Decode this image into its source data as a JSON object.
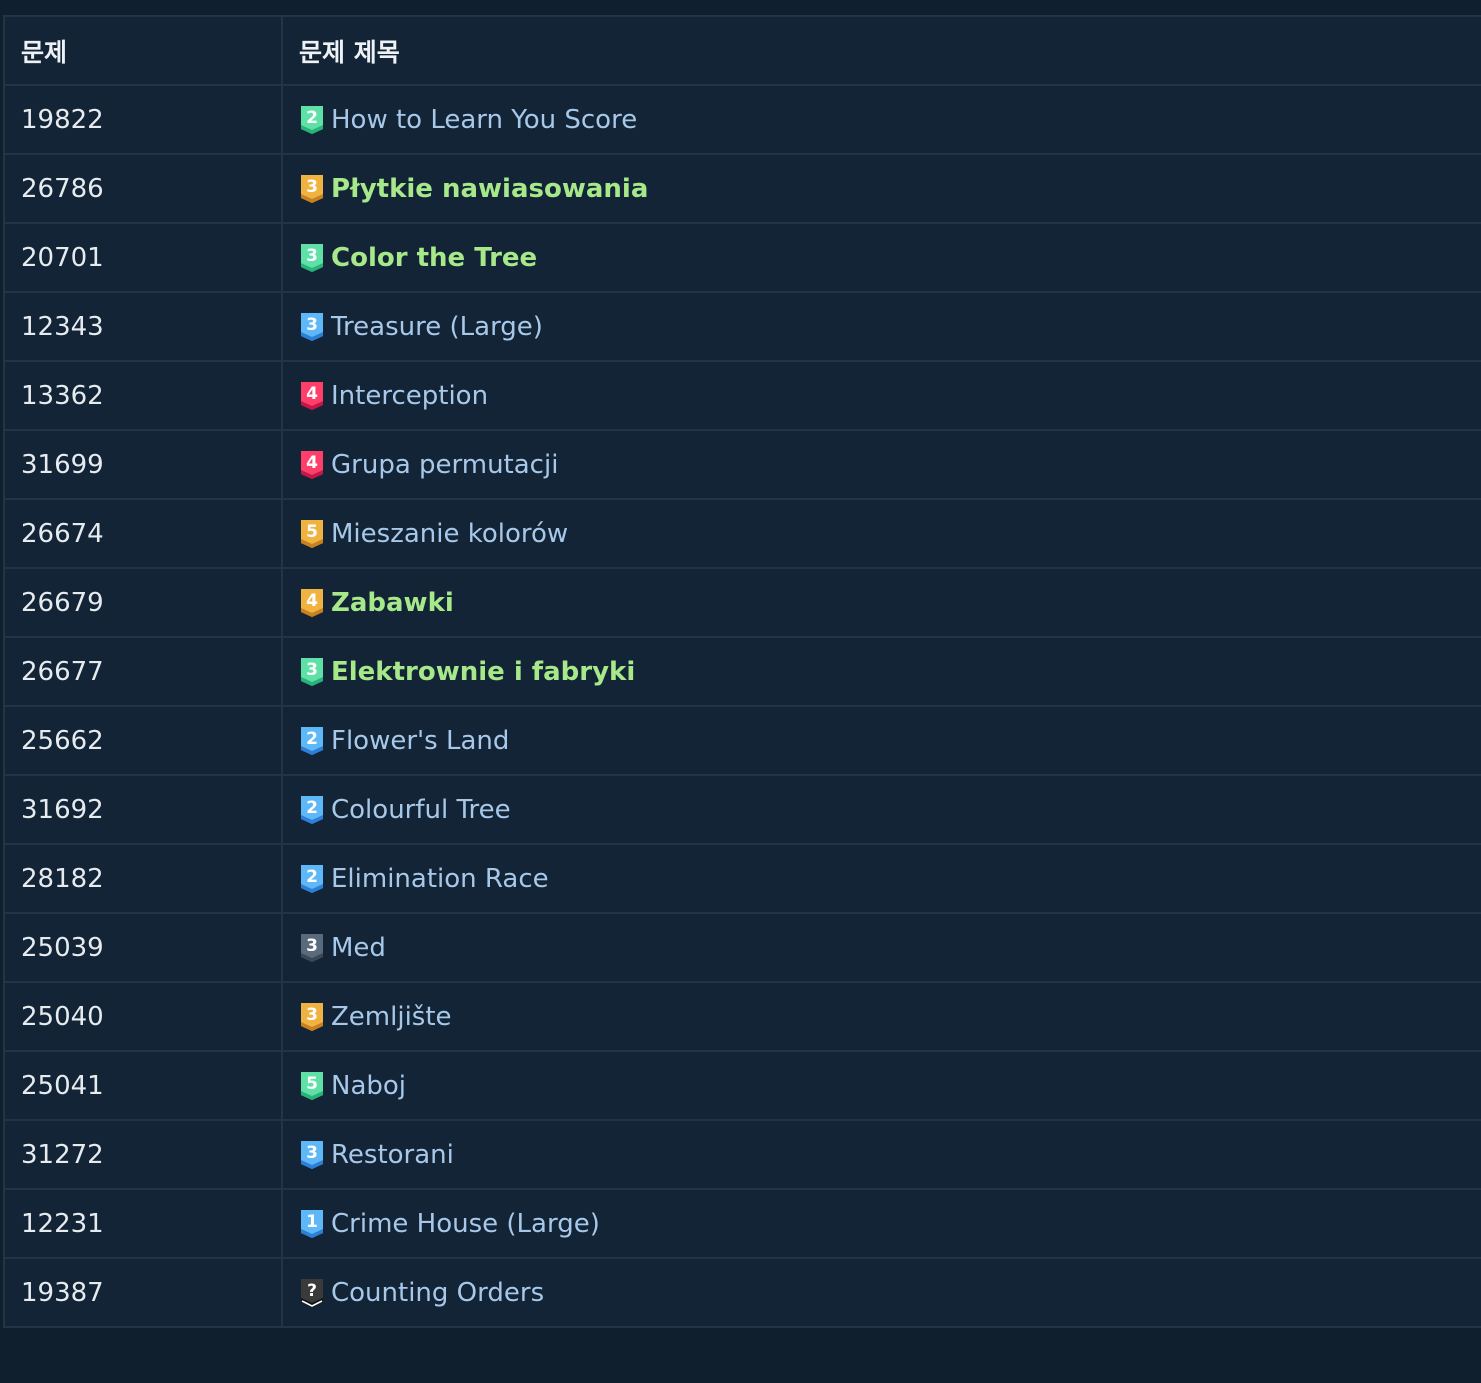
{
  "table": {
    "headers": [
      "문제",
      "문제 제목"
    ],
    "rows": [
      {
        "id": "19822",
        "title": "How to Learn You Score",
        "level": "2",
        "tier": "emerald",
        "solved": false
      },
      {
        "id": "26786",
        "title": "Płytkie nawiasowania",
        "level": "3",
        "tier": "gold",
        "solved": true
      },
      {
        "id": "20701",
        "title": "Color the Tree",
        "level": "3",
        "tier": "emerald",
        "solved": true
      },
      {
        "id": "12343",
        "title": "Treasure (Large)",
        "level": "3",
        "tier": "diamond",
        "solved": false
      },
      {
        "id": "13362",
        "title": "Interception",
        "level": "4",
        "tier": "ruby",
        "solved": false
      },
      {
        "id": "31699",
        "title": "Grupa permutacji",
        "level": "4",
        "tier": "ruby",
        "solved": false
      },
      {
        "id": "26674",
        "title": "Mieszanie kolorów",
        "level": "5",
        "tier": "gold",
        "solved": false
      },
      {
        "id": "26679",
        "title": "Zabawki",
        "level": "4",
        "tier": "gold",
        "solved": true
      },
      {
        "id": "26677",
        "title": "Elektrownie i fabryki",
        "level": "3",
        "tier": "emerald",
        "solved": true
      },
      {
        "id": "25662",
        "title": "Flower's Land",
        "level": "2",
        "tier": "diamond",
        "solved": false
      },
      {
        "id": "31692",
        "title": "Colourful Tree",
        "level": "2",
        "tier": "diamond",
        "solved": false
      },
      {
        "id": "28182",
        "title": "Elimination Race",
        "level": "2",
        "tier": "diamond",
        "solved": false
      },
      {
        "id": "25039",
        "title": "Med",
        "level": "3",
        "tier": "silver",
        "solved": false
      },
      {
        "id": "25040",
        "title": "Zemljište",
        "level": "3",
        "tier": "gold",
        "solved": false
      },
      {
        "id": "25041",
        "title": "Naboj",
        "level": "5",
        "tier": "emerald",
        "solved": false
      },
      {
        "id": "31272",
        "title": "Restorani",
        "level": "3",
        "tier": "diamond",
        "solved": false
      },
      {
        "id": "12231",
        "title": "Crime House (Large)",
        "level": "1",
        "tier": "diamond",
        "solved": false
      },
      {
        "id": "19387",
        "title": "Counting Orders",
        "level": "?",
        "tier": "unrated",
        "solved": false
      }
    ]
  },
  "tier_colors": {
    "emerald": {
      "light": "#5fe0a6",
      "dark": "#27b37a"
    },
    "gold": {
      "light": "#f0b341",
      "dark": "#c9801e"
    },
    "diamond": {
      "light": "#5eb8f7",
      "dark": "#2b7fd6"
    },
    "ruby": {
      "light": "#ff3f6a",
      "dark": "#c41748"
    },
    "silver": {
      "light": "#5a6a7d",
      "dark": "#3b4858"
    },
    "unrated": {
      "light": "#3a3a3a",
      "dark": "#111111"
    }
  },
  "colors": {
    "background": "#0f1f2e",
    "table_bg": "#122435",
    "border": "#223445",
    "link": "#a8c8ea",
    "solved_link": "#a6e88a"
  },
  "icons": {
    "tier": "tier-badge-icon"
  }
}
